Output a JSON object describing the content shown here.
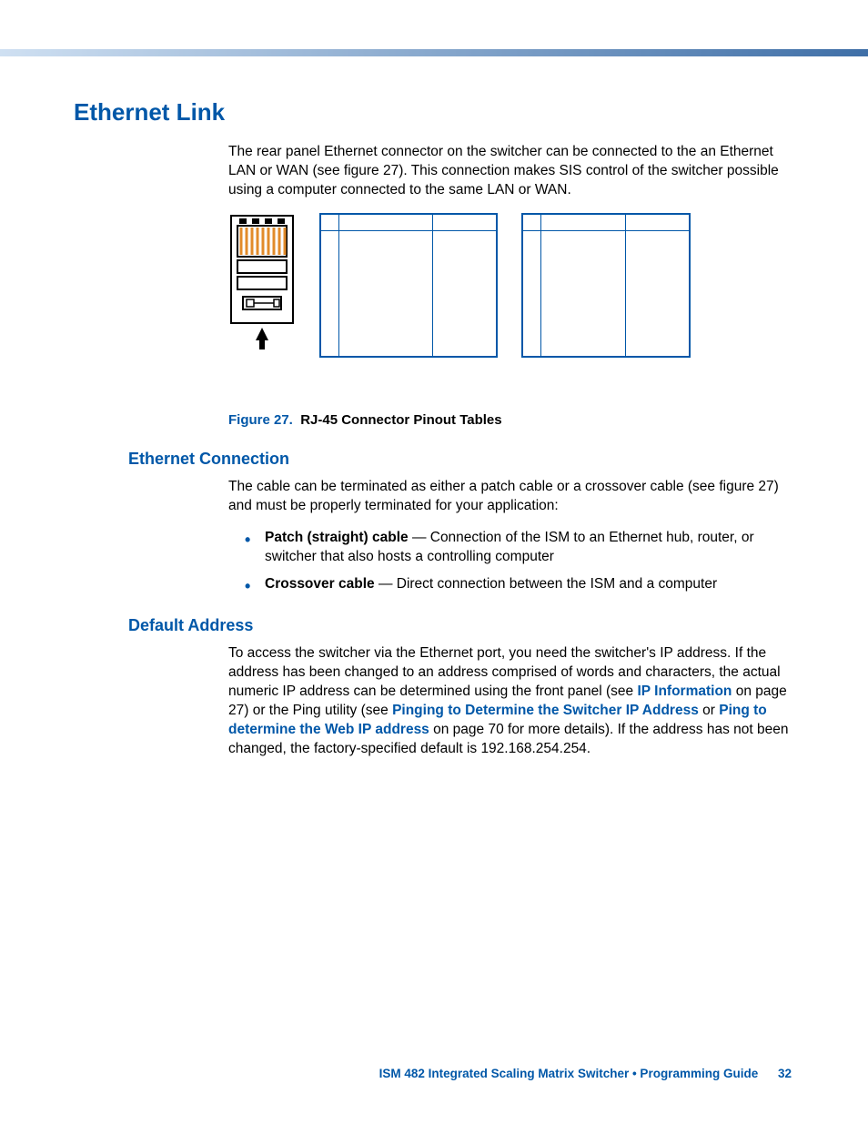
{
  "h1": "Ethernet Link",
  "intro": "The rear panel Ethernet connector on the switcher can be connected to the an Ethernet LAN or WAN (see figure 27).  This connection makes SIS control of the switcher possible using a computer connected to the same LAN or WAN.",
  "figure": {
    "num": "Figure 27.",
    "title": "RJ-45 Connector Pinout Tables"
  },
  "sec1": {
    "title": "Ethernet Connection",
    "para": "The cable can be terminated as either a patch cable or a crossover cable (see figure 27) and must be properly terminated for your application:",
    "b1": {
      "label": "Patch (straight) cable",
      "text": " — Connection of the ISM to an Ethernet hub, router, or switcher that also hosts a controlling computer"
    },
    "b2": {
      "label": "Crossover cable",
      "text": " — Direct connection between the ISM and a computer"
    }
  },
  "sec2": {
    "title": "Default Address",
    "t1": "To access the switcher via the Ethernet port, you need the switcher's IP address.  If the address has been changed to an address comprised of words and characters, the actual numeric IP address can be determined using the front panel (see ",
    "link1": "IP Information",
    "t2": " on page 27) or the Ping utility (see ",
    "link2": "Pinging to Determine the Switcher IP Address",
    "t3": " or ",
    "link3": "Ping to determine the Web IP address",
    "t4": " on page 70 for more details).  If the address has not been changed, the factory-specified default is 192.168.254.254."
  },
  "footer": {
    "text": "ISM 482 Integrated Scaling Matrix Switcher • Programming Guide",
    "page": "32"
  }
}
